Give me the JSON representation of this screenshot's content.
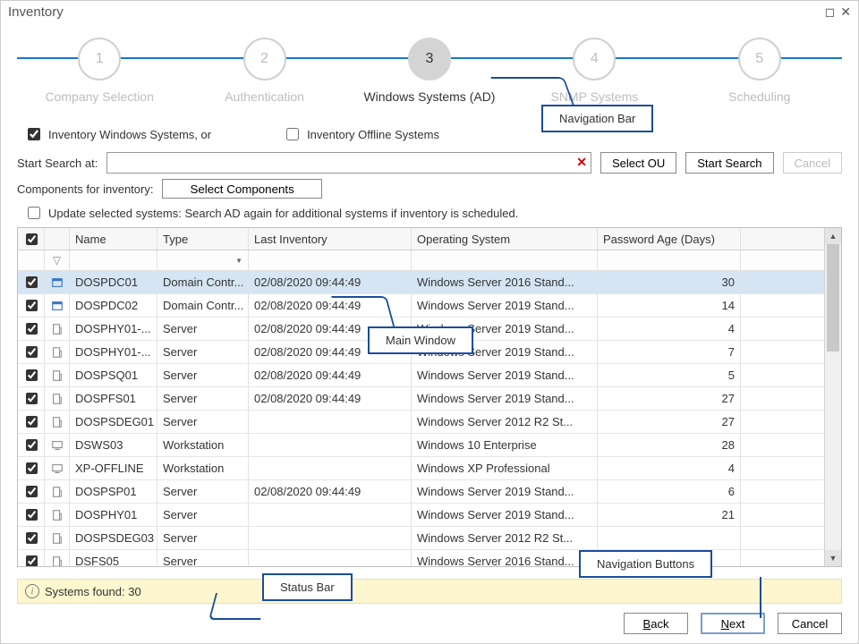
{
  "title": "Inventory",
  "steps": [
    {
      "n": "1",
      "label": "Company Selection",
      "active": false
    },
    {
      "n": "2",
      "label": "Authentication",
      "active": false
    },
    {
      "n": "3",
      "label": "Windows Systems (AD)",
      "active": true
    },
    {
      "n": "4",
      "label": "SNMP Systems",
      "active": false
    },
    {
      "n": "5",
      "label": "Scheduling",
      "active": false
    }
  ],
  "opt_inventory_windows": "Inventory Windows Systems, or",
  "opt_inventory_offline": "Inventory Offline Systems",
  "start_search_label": "Start Search at:",
  "btn_select_ou": "Select OU",
  "btn_start_search": "Start Search",
  "btn_cancel": "Cancel",
  "components_label": "Components for inventory:",
  "btn_select_components": "Select Components",
  "update_selected": "Update selected systems: Search AD again for additional systems if inventory is scheduled.",
  "columns": {
    "name": "Name",
    "type": "Type",
    "last": "Last Inventory",
    "os": "Operating System",
    "age": "Password Age (Days)"
  },
  "rows": [
    {
      "name": "DOSPDC01",
      "type": "Domain Contr...",
      "last": "02/08/2020 09:44:49",
      "os": "Windows Server 2016 Stand...",
      "age": "30",
      "icon": "server"
    },
    {
      "name": "DOSPDC02",
      "type": "Domain Contr...",
      "last": "02/08/2020 09:44:49",
      "os": "Windows Server 2019 Stand...",
      "age": "14",
      "icon": "server",
      "os_pre": "rver 2019 Stand..."
    },
    {
      "name": "DOSPHY01-...",
      "type": "Server",
      "last": "02/08/2020 09:44:49",
      "os": "Windows Server 2019 Stand...",
      "age": "4",
      "icon": "pc"
    },
    {
      "name": "DOSPHY01-...",
      "type": "Server",
      "last": "02/08/2020 09:44:49",
      "os": "Windows Server 2019 Stand...",
      "age": "7",
      "icon": "pc"
    },
    {
      "name": "DOSPSQ01",
      "type": "Server",
      "last": "02/08/2020 09:44:49",
      "os": "Windows Server 2019 Stand...",
      "age": "5",
      "icon": "pc"
    },
    {
      "name": "DOSPFS01",
      "type": "Server",
      "last": "02/08/2020 09:44:49",
      "os": "Windows Server 2019 Stand...",
      "age": "27",
      "icon": "pc"
    },
    {
      "name": "DOSPSDEG01",
      "type": "Server",
      "last": "",
      "os": "Windows Server 2012 R2 St...",
      "age": "27",
      "icon": "pc"
    },
    {
      "name": "DSWS03",
      "type": "Workstation",
      "last": "",
      "os": "Windows 10 Enterprise",
      "age": "28",
      "icon": "ws"
    },
    {
      "name": "XP-OFFLINE",
      "type": "Workstation",
      "last": "",
      "os": "Windows XP Professional",
      "age": "4",
      "icon": "ws"
    },
    {
      "name": "DOSPSP01",
      "type": "Server",
      "last": "02/08/2020 09:44:49",
      "os": "Windows Server 2019 Stand...",
      "age": "6",
      "icon": "pc"
    },
    {
      "name": "DOSPHY01",
      "type": "Server",
      "last": "",
      "os": "Windows Server 2019 Stand...",
      "age": "21",
      "icon": "pc"
    },
    {
      "name": "DOSPSDEG03",
      "type": "Server",
      "last": "",
      "os": "Windows Server 2012 R2 St...",
      "age": "",
      "icon": "pc"
    },
    {
      "name": "DSFS05",
      "type": "Server",
      "last": "",
      "os": "Windows Server 2016 Stand...",
      "age": "",
      "icon": "pc"
    }
  ],
  "status_text": "Systems found:  30",
  "nav": {
    "back": "Back",
    "next": "Next",
    "cancel": "Cancel"
  },
  "callouts": {
    "navbar": "Navigation Bar",
    "main": "Main Window",
    "status": "Status Bar",
    "navbtns": "Navigation Buttons"
  }
}
